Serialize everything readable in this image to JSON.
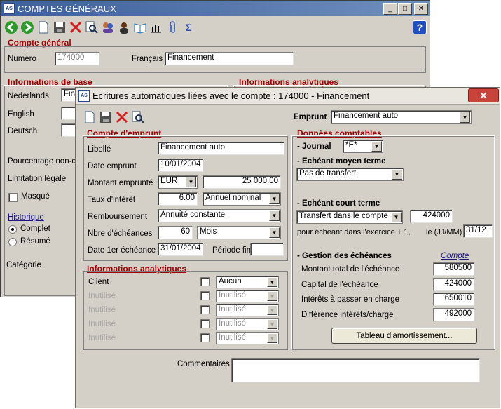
{
  "back_window": {
    "title": "COMPTES GÉNÉRAUX",
    "controls": {
      "minimize": "_",
      "maximize": "□",
      "close": "✕"
    },
    "help_label": "?",
    "compte_general": {
      "heading": "Compte général",
      "numero_label": "Numéro",
      "numero_value": "174000",
      "francais_label": "Français",
      "francais_value": "Financement"
    },
    "infos_base": {
      "heading": "Informations de base",
      "nederlands_label": "Nederlands",
      "nederlands_value": "Fina",
      "english_label": "English",
      "deutsch_label": "Deutsch",
      "pourcentage_label": "Pourcentage non-dé",
      "limitation_label": "Limitation légale",
      "masque_label": "Masqué",
      "historique_label": "Historique",
      "complet_label": "Complet",
      "resume_label": "Résumé",
      "categorie_label": "Catégorie"
    },
    "infos_analytiques_heading": "Informations analytiques"
  },
  "front_window": {
    "title": "Ecritures automatiques liées avec le compte : 174000 - Financement",
    "close_label": "✕",
    "emprunt_label": "Emprunt",
    "emprunt_value": "Financement auto",
    "compte_emprunt": {
      "heading": "Compte d'emprunt",
      "libelle_label": "Libellé",
      "libelle_value": "Financement auto",
      "date_emprunt_label": "Date emprunt",
      "date_emprunt_value": "10/01/2004",
      "montant_label": "Montant emprunté",
      "currency": "EUR",
      "montant_value": "25 000.00",
      "taux_label": "Taux d'intérêt",
      "taux_value": "6.00",
      "taux_type": "Annuel nominal",
      "remboursement_label": "Remboursement",
      "remboursement_value": "Annuité constante",
      "nbre_label": "Nbre d'échéances",
      "nbre_value": "60",
      "nbre_unit": "Mois",
      "date_1er_label": "Date 1er échéance",
      "date_1er_value": "31/01/2004",
      "periode_fin_label": "Période fin",
      "periode_fin_value": ""
    },
    "infos_analytiques": {
      "heading": "Informations analytiques",
      "rows": [
        {
          "label": "Client",
          "value": "Aucun"
        },
        {
          "label": "Inutilisé",
          "value": "Inutilisé"
        },
        {
          "label": "Inutilisé",
          "value": "Inutilisé"
        },
        {
          "label": "Inutilisé",
          "value": "Inutilisé"
        },
        {
          "label": "Inutilisé",
          "value": "Inutilisé"
        }
      ]
    },
    "donnees": {
      "heading": "Données comptables",
      "journal_label": "- Journal",
      "journal_value": "*E*",
      "moyen_terme_label": "- Echéant moyen terme",
      "moyen_terme_value": "Pas de transfert",
      "court_terme_label": "- Echéant court terme",
      "court_terme_value": "Transfert dans le compte",
      "court_terme_compte": "424000",
      "exercice_label": "pour échéant dans l'exercice + 1,",
      "le_label": "le (JJ/MM)",
      "le_value": "31/12",
      "gestion_label": "- Gestion des échéances",
      "compte_col_label": "Compte",
      "montant_total_label": "Montant total de l'échéance",
      "montant_total_value": "580500",
      "capital_label": "Capital de l'échéance",
      "capital_value": "424000",
      "interets_label": "Intérêts à passer en charge",
      "interets_value": "650010",
      "difference_label": "Différence intérêts/charge",
      "difference_value": "492000",
      "tableau_button": "Tableau d'amortissement..."
    },
    "commentaires_label": "Commentaires",
    "commentaires_value": ""
  }
}
